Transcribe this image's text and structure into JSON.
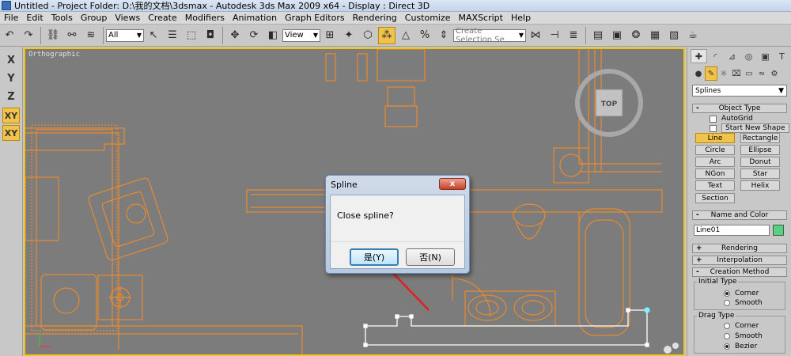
{
  "window": {
    "title": "Untitled    - Project Folder: D:\\我的文档\\3dsmax    - Autodesk 3ds Max  2009 x64     - Display : Direct 3D"
  },
  "menu": [
    "File",
    "Edit",
    "Tools",
    "Group",
    "Views",
    "Create",
    "Modifiers",
    "Animation",
    "Graph Editors",
    "Rendering",
    "Customize",
    "MAXScript",
    "Help"
  ],
  "toolbar": {
    "filter_select": "All",
    "coord_select": "View",
    "named_selection_placeholder": "Create Selection Se"
  },
  "axes": [
    "X",
    "Y",
    "Z",
    "XY",
    "XY"
  ],
  "viewport": {
    "label": "Orthographic",
    "viewcube_label": "TOP"
  },
  "dialog": {
    "title": "Spline",
    "close_glyph": "x",
    "message": "Close spline?",
    "yes_label": "是(Y)",
    "no_label": "否(N)"
  },
  "panel": {
    "category_dropdown": "Splines",
    "object_type_title": "Object Type",
    "autogrid_label": "AutoGrid",
    "start_new_shape_label": "Start New Shape",
    "object_buttons": [
      "Line",
      "Rectangle",
      "Circle",
      "Ellipse",
      "Arc",
      "Donut",
      "NGon",
      "Star",
      "Text",
      "Helix",
      "Section"
    ],
    "name_color_title": "Name and Color",
    "object_name": "Line01",
    "rendering_title": "Rendering",
    "interpolation_title": "Interpolation",
    "creation_method_title": "Creation Method",
    "initial_type_label": "Initial Type",
    "initial_options": [
      "Corner",
      "Smooth"
    ],
    "drag_type_label": "Drag Type",
    "drag_options": [
      "Corner",
      "Smooth",
      "Bezier"
    ],
    "expand_sign": "+",
    "collapse_sign": "-"
  },
  "colors": {
    "viewport_bg": "#7c7c7c",
    "plan_lines": "#e88a2e",
    "active_border": "#f2c51a",
    "highlight": "#f1c34a",
    "spline": "#ffffff",
    "arrow": "#e02020"
  }
}
